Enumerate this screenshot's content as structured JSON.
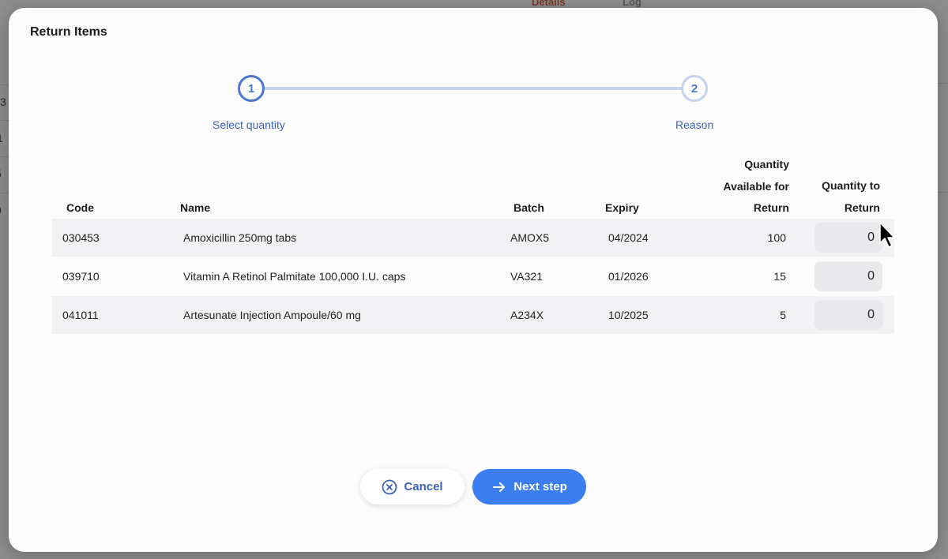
{
  "background": {
    "tabs": [
      "Details",
      "Log"
    ],
    "row_fragments": [
      "3",
      "1",
      "5",
      "0"
    ]
  },
  "modal": {
    "title": "Return Items"
  },
  "stepper": {
    "steps": [
      {
        "number": "1",
        "label": "Select quantity",
        "state": "active"
      },
      {
        "number": "2",
        "label": "Reason",
        "state": "inactive"
      }
    ]
  },
  "table": {
    "headers": {
      "code": "Code",
      "name": "Name",
      "batch": "Batch",
      "expiry": "Expiry",
      "available_l1": "Quantity",
      "available_l2": "Available for",
      "available_l3": "Return",
      "to_return_l1": "Quantity to",
      "to_return_l2": "Return"
    },
    "rows": [
      {
        "code": "030453",
        "name": "Amoxicillin 250mg tabs",
        "batch": "AMOX5",
        "expiry": "04/2024",
        "available": "100",
        "to_return": "0"
      },
      {
        "code": "039710",
        "name": "Vitamin A Retinol Palmitate 100,000 I.U. caps",
        "batch": "VA321",
        "expiry": "01/2026",
        "available": "15",
        "to_return": "0"
      },
      {
        "code": "041011",
        "name": "Artesunate Injection Ampoule/60 mg",
        "batch": "A234X",
        "expiry": "10/2025",
        "available": "5",
        "to_return": "0"
      }
    ]
  },
  "buttons": {
    "cancel": {
      "label": "Cancel",
      "icon": "close-circle-icon"
    },
    "next": {
      "label": "Next step",
      "icon": "arrow-right-icon"
    }
  },
  "colors": {
    "accent": "#3b7ef2",
    "step_active": "#4a78d0",
    "step_inactive": "#c2d3ef"
  }
}
